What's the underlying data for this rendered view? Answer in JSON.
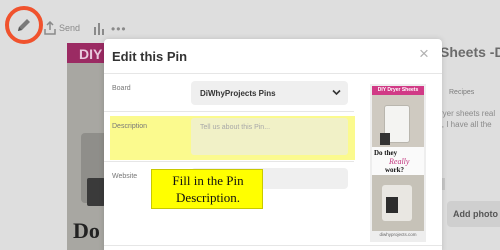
{
  "toolbar": {
    "edit_icon": "pencil-icon",
    "send_label": "Send",
    "stats_icon": "bar-chart-icon",
    "more_label": "•••"
  },
  "background": {
    "pin_banner": "DIY",
    "pin_caption": "Do",
    "right_title": "Sheets -Do",
    "recipes_label": "Recipes",
    "desc_line1": "ryer sheets real",
    "desc_line2": "l, I have all the",
    "add_photo_label": "Add photo co"
  },
  "modal": {
    "title": "Edit this Pin",
    "close_label": "×",
    "board": {
      "label": "Board",
      "value": "DiWhyProjects Pins"
    },
    "description": {
      "label": "Description",
      "placeholder": "Tell us about this Pin..."
    },
    "website": {
      "label": "Website",
      "value": ""
    },
    "preview": {
      "banner": "DIY Dryer Sheets",
      "line1": "Do they",
      "line2": "Really",
      "line3": "work?",
      "site": "diwhyprojects.com"
    }
  },
  "callout": {
    "line1": "Fill in the Pin",
    "line2": "Description."
  },
  "colors": {
    "highlight_circle": "#f0522d",
    "callout_bg": "#ffff00",
    "description_highlight": "#fbfa8e",
    "pin_banner": "#9b2b63"
  }
}
